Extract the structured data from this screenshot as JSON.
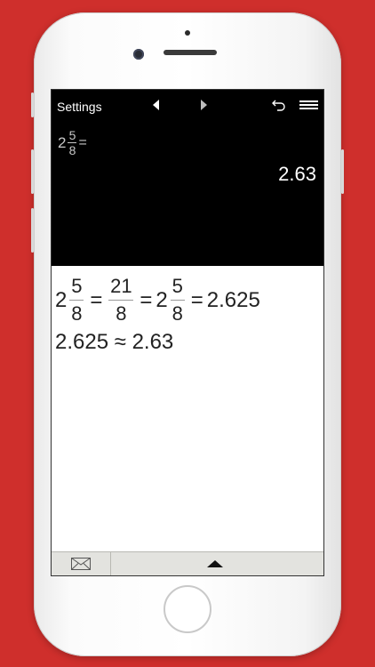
{
  "nav": {
    "settings_label": "Settings"
  },
  "display": {
    "input": {
      "whole": "2",
      "numerator": "5",
      "denominator": "8",
      "equals": "="
    },
    "result": "2.63"
  },
  "work": {
    "line1": {
      "whole1": "2",
      "num1": "5",
      "den1": "8",
      "eq1": "=",
      "num2": "21",
      "den2": "8",
      "eq2": "=",
      "whole3": "2",
      "num3": "5",
      "den3": "8",
      "eq3": "=",
      "decimal": "2.625"
    },
    "line2": "2.625 ≈ 2.63"
  },
  "icons": {
    "back": "triangle-left-icon",
    "forward": "triangle-right-icon",
    "undo": "undo-icon",
    "menu": "hamburger-menu-icon",
    "mail": "envelope-icon",
    "expand": "triangle-up-icon"
  },
  "colors": {
    "background": "#cf2f2c",
    "display_bg": "#000000",
    "bottom_bar": "#e3e3df"
  }
}
